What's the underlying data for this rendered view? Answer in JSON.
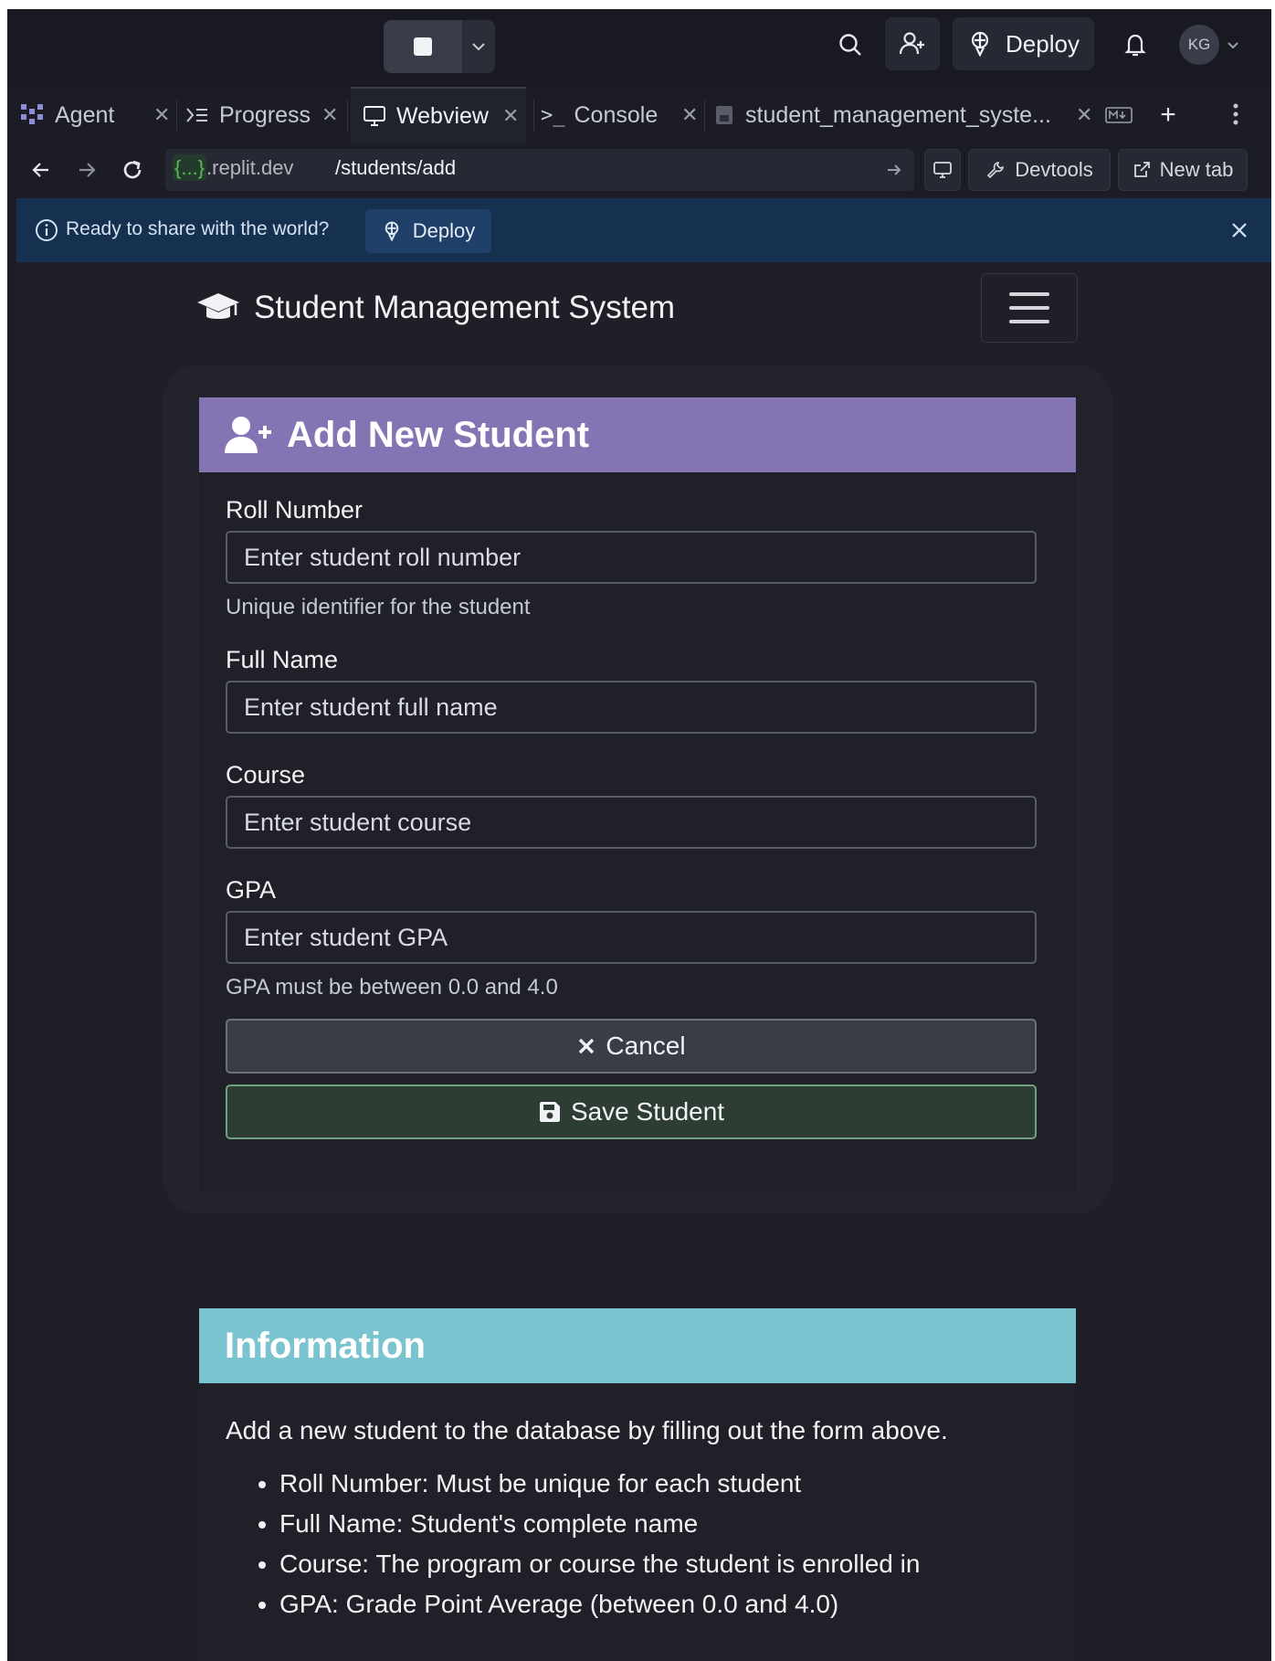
{
  "topbar": {
    "deploy_label": "Deploy",
    "avatar_initials": "KG"
  },
  "tabs": [
    {
      "label": "Agent"
    },
    {
      "label": "Progress"
    },
    {
      "label": "Webview"
    },
    {
      "label": "Console"
    },
    {
      "label": "student_management_syste..."
    }
  ],
  "urlbar": {
    "host_prefix": "{...}",
    "host_suffix": ".replit.dev",
    "path": "/students/add",
    "devtools_label": "Devtools",
    "newtab_label": "New tab"
  },
  "banner": {
    "text": "Ready to share with the world?",
    "deploy_label": "Deploy"
  },
  "app": {
    "brand": "Student Management System",
    "card_title": "Add New Student",
    "fields": {
      "roll": {
        "label": "Roll Number",
        "placeholder": "Enter student roll number",
        "help": "Unique identifier for the student"
      },
      "name": {
        "label": "Full Name",
        "placeholder": "Enter student full name"
      },
      "course": {
        "label": "Course",
        "placeholder": "Enter student course"
      },
      "gpa": {
        "label": "GPA",
        "placeholder": "Enter student GPA",
        "help": "GPA must be between 0.0 and 4.0"
      }
    },
    "cancel_label": "Cancel",
    "save_label": "Save Student",
    "info": {
      "title": "Information",
      "text": "Add a new student to the database by filling out the form above.",
      "items": [
        "Roll Number: Must be unique for each student",
        "Full Name: Student's complete name",
        "Course: The program or course the student is enrolled in",
        "GPA: Grade Point Average (between 0.0 and 4.0)"
      ]
    }
  }
}
